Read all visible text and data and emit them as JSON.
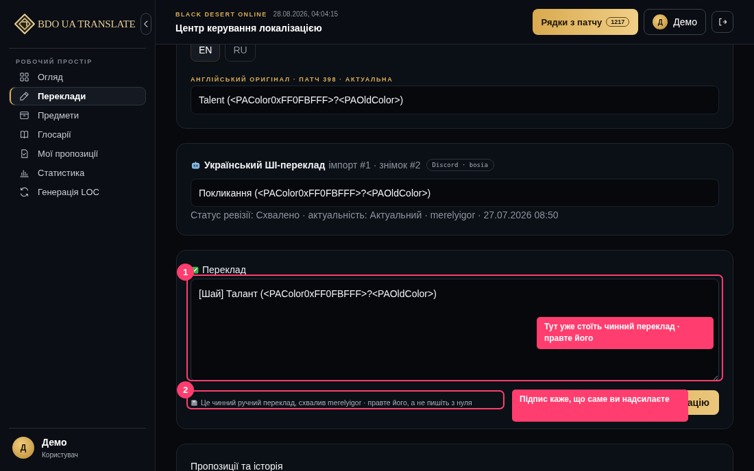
{
  "sidebar": {
    "logo_text": "BDO UA TRANSLATE",
    "section_label": "РОБОЧИЙ ПРОСТІР",
    "items": [
      {
        "kind": "grid",
        "label": "Огляд",
        "selected": false
      },
      {
        "kind": "pencil",
        "label": "Переклади",
        "selected": true
      },
      {
        "kind": "box",
        "label": "Предмети",
        "selected": false
      },
      {
        "kind": "book",
        "label": "Глосарії",
        "selected": false
      },
      {
        "kind": "doc",
        "label": "Мої пропозиції",
        "selected": false
      },
      {
        "kind": "chart",
        "label": "Статистика",
        "selected": false
      },
      {
        "kind": "refresh",
        "label": "Генерація LOC",
        "selected": false
      }
    ],
    "user": {
      "avatar": "Д",
      "name": "Демо",
      "role": "Користувач"
    }
  },
  "header": {
    "eyebrow": "BLACK DESERT ONLINE",
    "timestamp": "28.08.2026, 04:04:15",
    "title": "Центр керування локалізацією",
    "patch_button": {
      "label": "Рядки з патчу",
      "count": "1217"
    },
    "user_button": {
      "avatar": "Д",
      "name": "Демо"
    }
  },
  "source_card": {
    "language_tabs": [
      {
        "label": "EN",
        "selected": true
      },
      {
        "label": "RU",
        "selected": false
      }
    ],
    "label": "АНГЛІЙСЬКИЙ ОРИГІНАЛ · ПАТЧ 398 · АКТУАЛЬНА",
    "text": "Talent (<PAColor0xFF0FBFFF>?<PAOldColor>)"
  },
  "ai_card": {
    "title": "Український ШІ-переклад",
    "meta": "імпорт #1 · знімок #2",
    "badge": "Discord · bosia",
    "text": "Покликання (<PAColor0xFF0FBFFF>?<PAOldColor>)",
    "status": "Статус ревізії: Схвалено · актуальність: Актуальний · merelyigor · 27.07.2026 08:50"
  },
  "translation_card": {
    "label": "Переклад",
    "value": "[Шай] Талант (<PAColor0xFF0FBFFF>?<PAOldColor>)",
    "caption": "Це чинний ручний переклад, схвалив merelyigor · правте його, а не пишіть з нуля",
    "submit_button": "ацію"
  },
  "history_card": {
    "title": "Пропозиції та історія"
  },
  "tour": {
    "steps": [
      {
        "number": "1",
        "callout": "Тут уже стоїть чинний переклад · правте його"
      },
      {
        "number": "2",
        "callout": "Підпис каже, що саме ви надсилаєте"
      }
    ]
  }
}
